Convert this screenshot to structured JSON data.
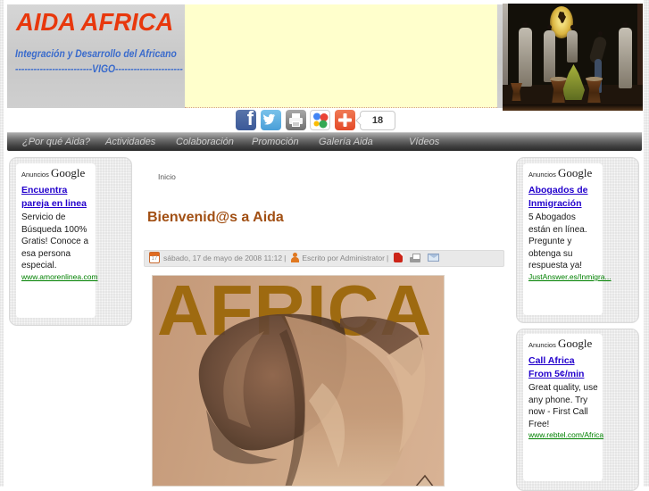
{
  "theme": {
    "title_red": "#e8380d",
    "subtitle_blue": "#3a6bcc",
    "banner_yellow": "#ffffcc",
    "heading_brown": "#a14f13",
    "ad_link_blue": "#2200cc",
    "ad_url_green": "#008000"
  },
  "header": {
    "title": "AIDA AFRICA",
    "subtitle_line1": "Integración y Desarrollo del Africano",
    "subtitle_line2": "-------------------------VIGO----------------------"
  },
  "share": {
    "count": "18"
  },
  "nav": {
    "items": [
      {
        "label": "¿Por qué Aida?"
      },
      {
        "label": "Actividades"
      },
      {
        "label": "Colaboración"
      },
      {
        "label": "Promoción"
      },
      {
        "label": "Galería Aida"
      },
      {
        "label": "Vídeos"
      }
    ]
  },
  "breadcrumb": "Inicio",
  "article": {
    "title": "Bienvenid@s a Aida",
    "date": "sábado, 17 de mayo de 2008 11:12",
    "byline": "Escrito por Administrator",
    "separator": "|",
    "image_title": "AFRICA"
  },
  "ads": {
    "label_prefix": "Anuncios",
    "label_brand": "Google",
    "left": {
      "headline": "Encuentra\npareja en linea",
      "body": "Servicio de\nBúsqueda 100%\nGratis! Conoce a\nesa persona\nespecial.",
      "url": "www.amorenlinea.com"
    },
    "right_top": {
      "headline": "Abogados de\nInmigración",
      "body": "5 Abogados\nestán en línea.\nPregunte y\nobtenga su\nrespuesta ya!",
      "url": "JustAnswer.es/Inmigra..."
    },
    "right_bottom": {
      "headline": "Call Africa\nFrom 5¢/min",
      "body": "Great quality, use\nany phone. Try\nnow - First Call\nFree!",
      "url": "www.rebtel.com/Africa"
    }
  }
}
